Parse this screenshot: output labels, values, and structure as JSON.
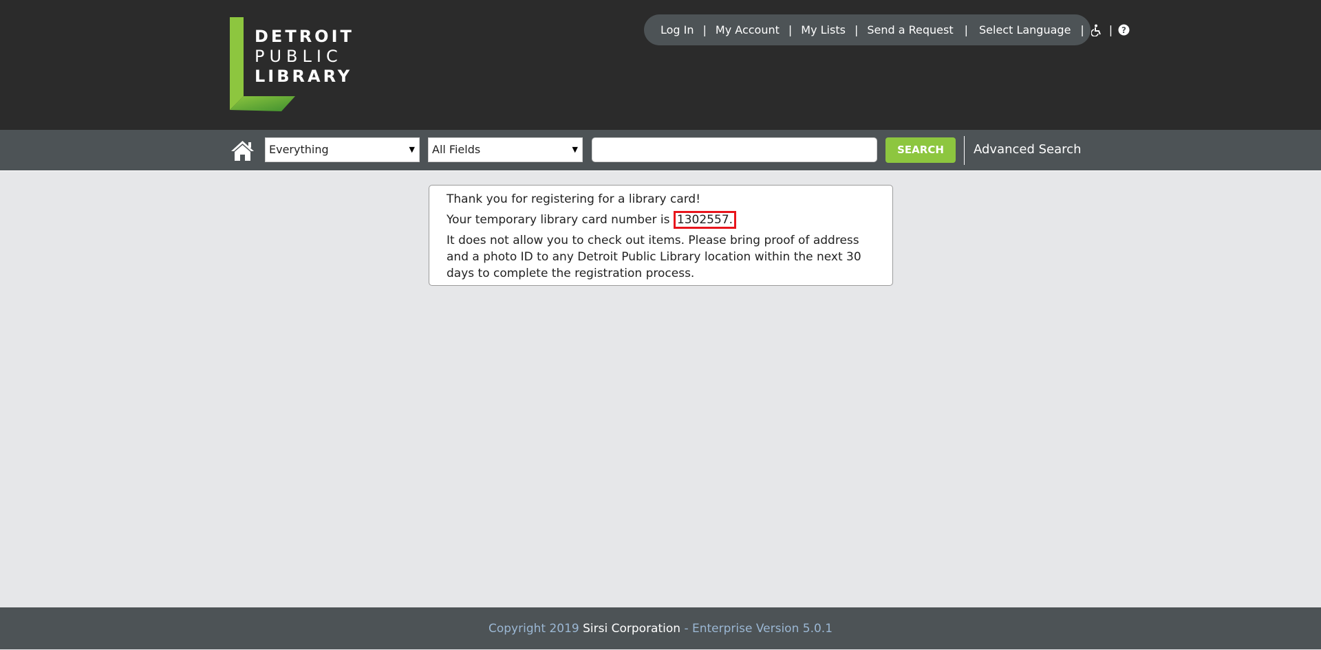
{
  "logo": {
    "line1": "DETROIT",
    "line2": "PUBLIC",
    "line3": "LIBRARY"
  },
  "toplinks": {
    "login": "Log In",
    "account": "My Account",
    "lists": "My Lists",
    "request": "Send a Request",
    "language": "Select Language",
    "separator": "|"
  },
  "search": {
    "library_select": "Everything",
    "field_select": "All Fields",
    "query": "",
    "button": "SEARCH",
    "advanced": "Advanced Search"
  },
  "message": {
    "thanks": "Thank you for registering for a library card!",
    "card_prefix": "Your temporary library card number is ",
    "card_number": "1302557.",
    "notice": "It does not allow you to check out items. Please bring proof of address and a photo ID to any Detroit Public Library location within the next 30 days to complete the registration process."
  },
  "footer": {
    "copyright": "Copyright 2019 ",
    "corporation": "Sirsi Corporation",
    "version": " - Enterprise Version 5.0.1"
  },
  "colors": {
    "header_bg": "#2b2b2b",
    "bar_bg": "#4d5356",
    "accent_green": "#8dc63f",
    "highlight_red": "#e8141b"
  }
}
